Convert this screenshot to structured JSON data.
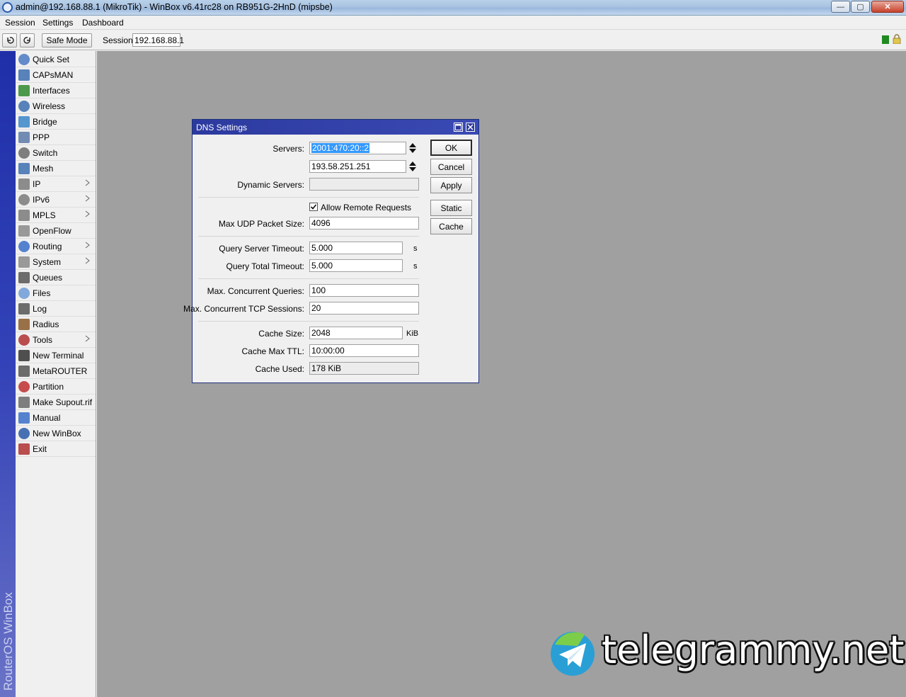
{
  "window": {
    "title": "admin@192.168.88.1 (MikroTik) - WinBox v6.41rc28 on RB951G-2HnD (mipsbe)",
    "minimize_glyph": "—",
    "maximize_glyph": "▢",
    "close_glyph": "✕"
  },
  "menubar": {
    "items": [
      "Session",
      "Settings",
      "Dashboard"
    ]
  },
  "toolbar": {
    "undo_icon": "undo-icon",
    "redo_icon": "redo-icon",
    "safe_mode_label": "Safe Mode",
    "session_label": "Session:",
    "session_value": "192.168.88.1",
    "status_color": "#1f8a1f"
  },
  "brand": {
    "text": "RouterOS WinBox",
    "stripe_color": "#1f2fa8"
  },
  "sidebar": {
    "items": [
      {
        "label": "Quick Set",
        "icon": "quick-set-icon",
        "submenu": false
      },
      {
        "label": "CAPsMAN",
        "icon": "capsman-icon",
        "submenu": false
      },
      {
        "label": "Interfaces",
        "icon": "interfaces-icon",
        "submenu": false
      },
      {
        "label": "Wireless",
        "icon": "wireless-icon",
        "submenu": false
      },
      {
        "label": "Bridge",
        "icon": "bridge-icon",
        "submenu": false
      },
      {
        "label": "PPP",
        "icon": "ppp-icon",
        "submenu": false
      },
      {
        "label": "Switch",
        "icon": "switch-icon",
        "submenu": false
      },
      {
        "label": "Mesh",
        "icon": "mesh-icon",
        "submenu": false
      },
      {
        "label": "IP",
        "icon": "ip-icon",
        "submenu": true
      },
      {
        "label": "IPv6",
        "icon": "ipv6-icon",
        "submenu": true
      },
      {
        "label": "MPLS",
        "icon": "mpls-icon",
        "submenu": true
      },
      {
        "label": "OpenFlow",
        "icon": "openflow-icon",
        "submenu": false
      },
      {
        "label": "Routing",
        "icon": "routing-icon",
        "submenu": true
      },
      {
        "label": "System",
        "icon": "system-icon",
        "submenu": true
      },
      {
        "label": "Queues",
        "icon": "queues-icon",
        "submenu": false
      },
      {
        "label": "Files",
        "icon": "files-icon",
        "submenu": false
      },
      {
        "label": "Log",
        "icon": "log-icon",
        "submenu": false
      },
      {
        "label": "Radius",
        "icon": "radius-icon",
        "submenu": false
      },
      {
        "label": "Tools",
        "icon": "tools-icon",
        "submenu": true
      },
      {
        "label": "New Terminal",
        "icon": "terminal-icon",
        "submenu": false
      },
      {
        "label": "MetaROUTER",
        "icon": "metarouter-icon",
        "submenu": false
      },
      {
        "label": "Partition",
        "icon": "partition-icon",
        "submenu": false
      },
      {
        "label": "Make Supout.rif",
        "icon": "supout-icon",
        "submenu": false
      },
      {
        "label": "Manual",
        "icon": "manual-icon",
        "submenu": false
      },
      {
        "label": "New WinBox",
        "icon": "winbox-icon",
        "submenu": false
      },
      {
        "label": "Exit",
        "icon": "exit-icon",
        "submenu": false
      }
    ]
  },
  "dns_dialog": {
    "title": "DNS Settings",
    "servers_label": "Servers:",
    "server_1": "2001:470:20::2",
    "server_2": "193.58.251.251",
    "dynamic_servers_label": "Dynamic Servers:",
    "dynamic_servers_value": "",
    "allow_remote_label": "Allow Remote Requests",
    "allow_remote_checked": true,
    "max_udp_label": "Max UDP Packet Size:",
    "max_udp_value": "4096",
    "query_server_timeout_label": "Query Server Timeout:",
    "query_server_timeout_value": "5.000",
    "query_total_timeout_label": "Query Total Timeout:",
    "query_total_timeout_value": "5.000",
    "seconds_unit": "s",
    "max_concurrent_queries_label": "Max. Concurrent Queries:",
    "max_concurrent_queries_value": "100",
    "max_tcp_sessions_label": "Max. Concurrent TCP Sessions:",
    "max_tcp_sessions_value": "20",
    "cache_size_label": "Cache Size:",
    "cache_size_value": "2048",
    "cache_size_unit": "KiB",
    "cache_max_ttl_label": "Cache Max TTL:",
    "cache_max_ttl_value": "10:00:00",
    "cache_used_label": "Cache Used:",
    "cache_used_value": "178 KiB",
    "buttons": {
      "ok": "OK",
      "cancel": "Cancel",
      "apply": "Apply",
      "static": "Static",
      "cache": "Cache"
    },
    "title_color": "#2c3a9f"
  },
  "watermark": {
    "text": "telegrammy.net",
    "logo_icon": "telegram-logo-icon"
  }
}
